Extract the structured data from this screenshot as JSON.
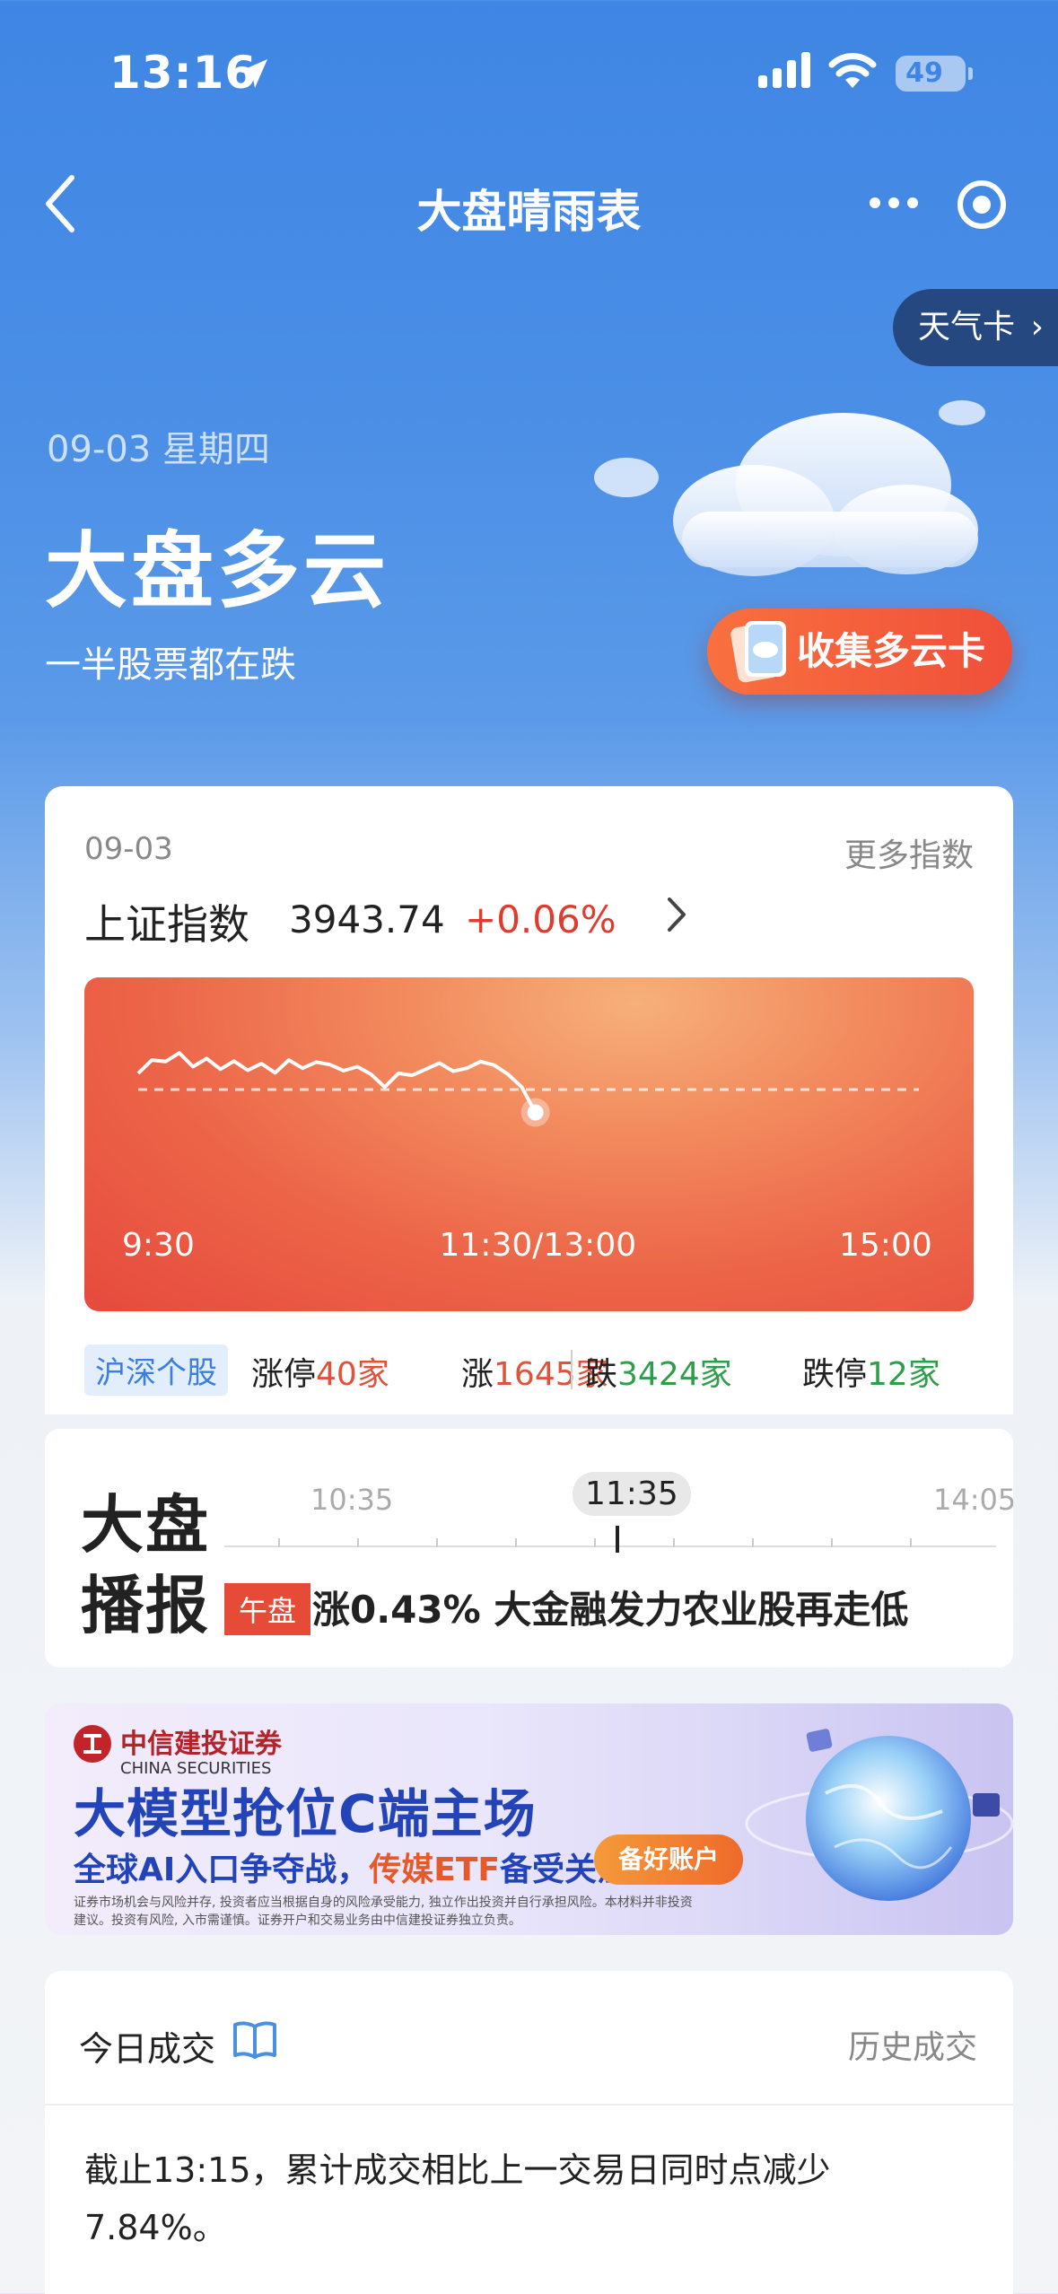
{
  "status_bar": {
    "time": "13:16",
    "battery": "49"
  },
  "nav": {
    "title": "大盘晴雨表"
  },
  "weather_tab": {
    "label": "天气卡",
    "arrow": "›"
  },
  "hero": {
    "date": "09-03 星期四",
    "title": "大盘多云",
    "subtitle": "一半股票都在跌",
    "collect_button": "收集多云卡"
  },
  "index_card": {
    "date": "09-03",
    "more_label": "更多指数",
    "index_name": "上证指数",
    "index_value": "3943.74",
    "index_change": "+0.06%",
    "chart_data": {
      "type": "line",
      "x_ticks": [
        "9:30",
        "11:30/13:00",
        "15:00"
      ],
      "series": [
        {
          "values": [
            0.32,
            0.58,
            0.55,
            0.72,
            0.45,
            0.61,
            0.4,
            0.56,
            0.38,
            0.51,
            0.33,
            0.58,
            0.42,
            0.54,
            0.49,
            0.37,
            0.45,
            0.3,
            0.05,
            0.32,
            0.28,
            0.4,
            0.52,
            0.36,
            0.42,
            0.55,
            0.48,
            0.3,
            0.05,
            -0.45
          ]
        }
      ],
      "baseline": 0,
      "baseline_style": "dashed",
      "ylim": [
        -1.5,
        1.5
      ]
    },
    "stats": {
      "tag": "沪深个股",
      "limit_up_label": "涨停",
      "limit_up": "40家",
      "up_label": "涨",
      "up": "1645家",
      "down_label": "跌",
      "down": "3424家",
      "limit_down_label": "跌停",
      "limit_down": "12家"
    }
  },
  "broadcast": {
    "logo_line1": "大盘",
    "logo_line2": "播报",
    "times": [
      "10:35",
      "11:35",
      "14:05"
    ],
    "tag": "午盘",
    "headline": "涨0.43% 大金融发力农业股再走低"
  },
  "ad": {
    "brand": "中信建投证券",
    "brand_en": "CHINA SECURITIES",
    "title": "大模型抢位C端主场",
    "subtitle_a": "全球AI入口争夺战，",
    "subtitle_b": "传媒ETF",
    "subtitle_c": "备受关注",
    "button": "备好账户",
    "fine_print": "证券市场机会与风险并存, 投资者应当根据自身的风险承受能力, 独立作出投资并自行承担风险。本材料并非投资建议。投资有风险, 入市需谨慎。证券开户和交易业务由中信建投证券独立负责。"
  },
  "turnover": {
    "title": "今日成交",
    "history_label": "历史成交",
    "description": "截止13:15，累计成交相比上一交易日同时点减少7.84%。"
  },
  "colors": {
    "accent_blue": "#3f86e4",
    "rise_red": "#e03b2e",
    "fall_green": "#2e9e4b",
    "chart_orange": "#ec6548"
  }
}
